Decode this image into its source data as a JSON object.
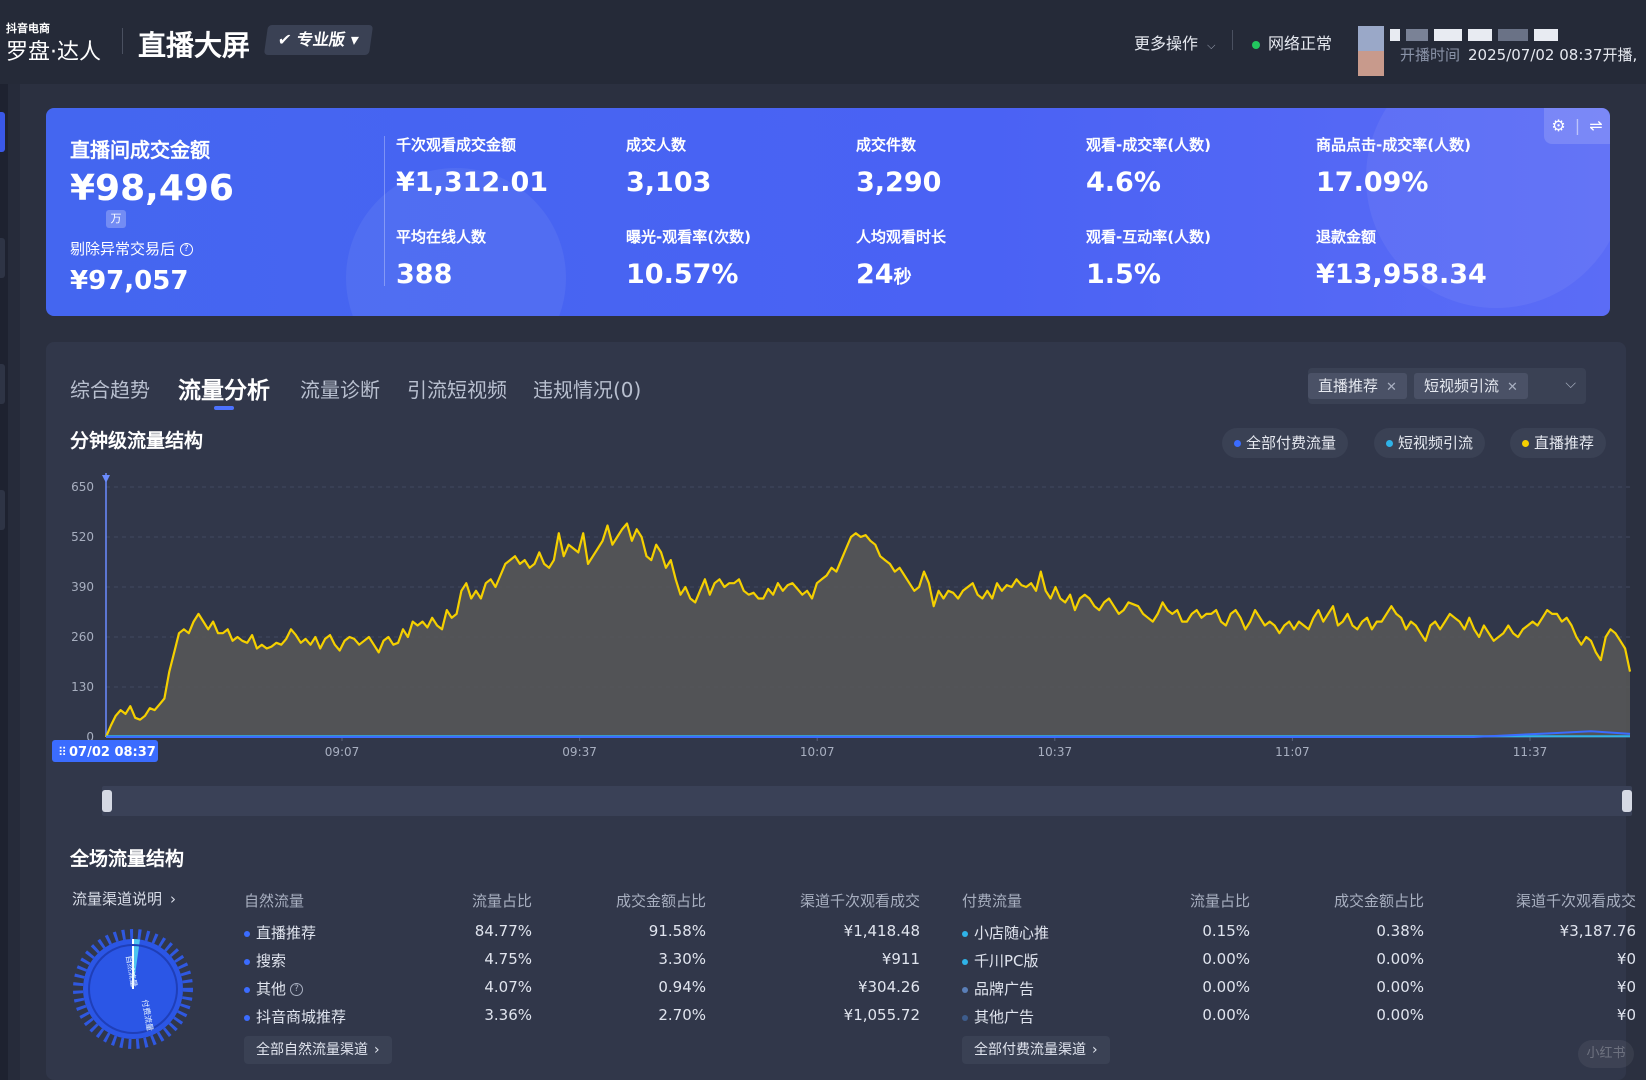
{
  "header": {
    "brand_small": "抖音电商",
    "brand_main": "罗盘·达人",
    "page_title": "直播大屏",
    "edition": "专业版",
    "more_ops": "更多操作",
    "network": "网络正常",
    "live_start_label": "开播时间",
    "live_start_value": "2025/07/02 08:37开播,"
  },
  "kpi": {
    "main_label": "直播间成交金额",
    "main_value": "¥98,496",
    "main_unit": "万",
    "sub_label": "剔除异常交易后",
    "sub_value": "¥97,057",
    "cells": [
      {
        "label": "千次观看成交金额",
        "value": "¥1,312.01"
      },
      {
        "label": "成交人数",
        "value": "3,103"
      },
      {
        "label": "成交件数",
        "value": "3,290"
      },
      {
        "label": "观看-成交率(人数)",
        "value": "4.6%"
      },
      {
        "label": "商品点击-成交率(人数)",
        "value": "17.09%"
      },
      {
        "label": "平均在线人数",
        "value": "388"
      },
      {
        "label": "曝光-观看率(次数)",
        "value": "10.57%"
      },
      {
        "label": "人均观看时长",
        "value": "24",
        "unit": "秒"
      },
      {
        "label": "观看-互动率(人数)",
        "value": "1.5%"
      },
      {
        "label": "退款金额",
        "value": "¥13,958.34"
      }
    ]
  },
  "tabs": [
    {
      "label": "综合趋势"
    },
    {
      "label": "流量分析",
      "active": true
    },
    {
      "label": "流量诊断"
    },
    {
      "label": "引流短视频"
    },
    {
      "label": "违规情况(0)"
    }
  ],
  "filters": [
    {
      "label": "直播推荐"
    },
    {
      "label": "短视频引流"
    }
  ],
  "minute_section": {
    "title": "分钟级流量结构",
    "legend": [
      {
        "label": "全部付费流量",
        "color": "#3b6cff"
      },
      {
        "label": "短视频引流",
        "color": "#2fb3e8"
      },
      {
        "label": "直播推荐",
        "color": "#f5d000"
      }
    ],
    "start_tag": "07/02 08:37"
  },
  "chart_data": {
    "type": "area",
    "ylim": [
      0,
      650
    ],
    "yticks": [
      "0",
      "130",
      "260",
      "390",
      "520",
      "650"
    ],
    "xticks": [
      "09:07",
      "09:37",
      "10:07",
      "10:37",
      "11:07",
      "11:37"
    ],
    "series": [
      {
        "name": "直播推荐",
        "color": "#f5d000",
        "values": [
          0,
          30,
          55,
          70,
          60,
          80,
          50,
          45,
          55,
          75,
          70,
          85,
          100,
          170,
          220,
          270,
          280,
          270,
          300,
          320,
          300,
          280,
          300,
          270,
          270,
          280,
          250,
          260,
          250,
          245,
          265,
          230,
          240,
          230,
          235,
          245,
          240,
          255,
          280,
          265,
          245,
          255,
          240,
          260,
          230,
          255,
          265,
          240,
          225,
          250,
          260,
          255,
          240,
          250,
          260,
          240,
          220,
          250,
          260,
          240,
          245,
          280,
          260,
          300,
          290,
          300,
          285,
          310,
          290,
          280,
          330,
          310,
          320,
          380,
          400,
          360,
          380,
          360,
          400,
          410,
          390,
          420,
          450,
          460,
          470,
          450,
          460,
          440,
          450,
          480,
          450,
          440,
          460,
          530,
          470,
          500,
          490,
          480,
          530,
          450,
          470,
          490,
          510,
          550,
          500,
          520,
          540,
          555,
          510,
          540,
          520,
          470,
          460,
          500,
          480,
          440,
          460,
          410,
          370,
          390,
          360,
          350,
          380,
          410,
          370,
          400,
          410,
          390,
          400,
          400,
          410,
          380,
          370,
          375,
          360,
          360,
          385,
          370,
          400,
          380,
          395,
          400,
          385,
          370,
          380,
          360,
          400,
          410,
          420,
          440,
          430,
          460,
          490,
          520,
          530,
          520,
          525,
          510,
          500,
          470,
          460,
          450,
          430,
          440,
          420,
          400,
          380,
          390,
          430,
          400,
          340,
          380,
          360,
          380,
          375,
          360,
          380,
          390,
          400,
          370,
          360,
          380,
          360,
          400,
          380,
          395,
          390,
          410,
          395,
          390,
          400,
          380,
          430,
          380,
          360,
          390,
          360,
          350,
          370,
          330,
          360,
          370,
          360,
          340,
          330,
          350,
          360,
          340,
          320,
          330,
          350,
          345,
          340,
          320,
          310,
          300,
          320,
          350,
          330,
          320,
          330,
          300,
          300,
          320,
          330,
          310,
          320,
          320,
          330,
          300,
          290,
          320,
          330,
          310,
          280,
          300,
          330,
          310,
          290,
          300,
          290,
          270,
          290,
          300,
          280,
          300,
          290,
          280,
          310,
          330,
          300,
          320,
          340,
          290,
          300,
          320,
          290,
          280,
          300,
          310,
          280,
          300,
          300,
          320,
          340,
          320,
          310,
          280,
          300,
          290,
          270,
          250,
          290,
          300,
          280,
          300,
          320,
          310,
          300,
          280,
          310,
          280,
          260,
          290,
          270,
          250,
          260,
          270,
          290,
          270,
          260,
          280,
          290,
          300,
          290,
          310,
          330,
          320,
          320,
          300,
          310,
          290,
          260,
          240,
          260,
          250,
          220,
          200,
          260,
          280,
          270,
          250,
          230,
          170
        ]
      },
      {
        "name": "短视频引流",
        "color": "#2fb3e8",
        "values": [
          2,
          2,
          2,
          2,
          2,
          2,
          2,
          2,
          2,
          2,
          2,
          2,
          2,
          2,
          2,
          2,
          2,
          2,
          2,
          2,
          2,
          2,
          2,
          2,
          2,
          2,
          2,
          2,
          2,
          2,
          2,
          2,
          2,
          2,
          2,
          2,
          2,
          2,
          2,
          2
        ]
      },
      {
        "name": "全部付费流量",
        "color": "#3b6cff",
        "values": [
          0,
          0,
          0,
          0,
          0,
          0,
          0,
          0,
          0,
          0,
          0,
          0,
          0,
          0,
          0,
          0,
          0,
          0,
          0,
          0,
          0,
          0,
          0,
          0,
          0,
          0,
          0,
          0,
          0,
          0,
          0,
          0,
          0,
          0,
          0,
          0,
          5,
          10,
          15,
          8
        ]
      }
    ]
  },
  "overall_section": {
    "title": "全场流量结构",
    "channel_note": "流量渠道说明",
    "donut_labels": [
      "自然流量",
      "付费流量"
    ],
    "natural": {
      "headers": [
        "自然流量",
        "流量占比",
        "成交金额占比",
        "渠道千次观看成交"
      ],
      "rows": [
        {
          "name": "直播推荐",
          "share": "84.77%",
          "gmv_share": "91.58%",
          "gpm": "¥1,418.48"
        },
        {
          "name": "搜索",
          "share": "4.75%",
          "gmv_share": "3.30%",
          "gpm": "¥911"
        },
        {
          "name": "其他",
          "share": "4.07%",
          "gmv_share": "0.94%",
          "gpm": "¥304.26"
        },
        {
          "name": "抖音商城推荐",
          "share": "3.36%",
          "gmv_share": "2.70%",
          "gpm": "¥1,055.72"
        }
      ],
      "button": "全部自然流量渠道"
    },
    "paid": {
      "headers": [
        "付费流量",
        "流量占比",
        "成交金额占比",
        "渠道千次观看成交"
      ],
      "rows": [
        {
          "name": "小店随心推",
          "share": "0.15%",
          "gmv_share": "0.38%",
          "gpm": "¥3,187.76"
        },
        {
          "name": "千川PC版",
          "share": "0.00%",
          "gmv_share": "0.00%",
          "gpm": "¥0"
        },
        {
          "name": "品牌广告",
          "share": "0.00%",
          "gmv_share": "0.00%",
          "gpm": "¥0"
        },
        {
          "name": "其他广告",
          "share": "0.00%",
          "gmv_share": "0.00%",
          "gpm": "¥0"
        }
      ],
      "button": "全部付费流量渠道"
    }
  },
  "watermark": "小红书"
}
